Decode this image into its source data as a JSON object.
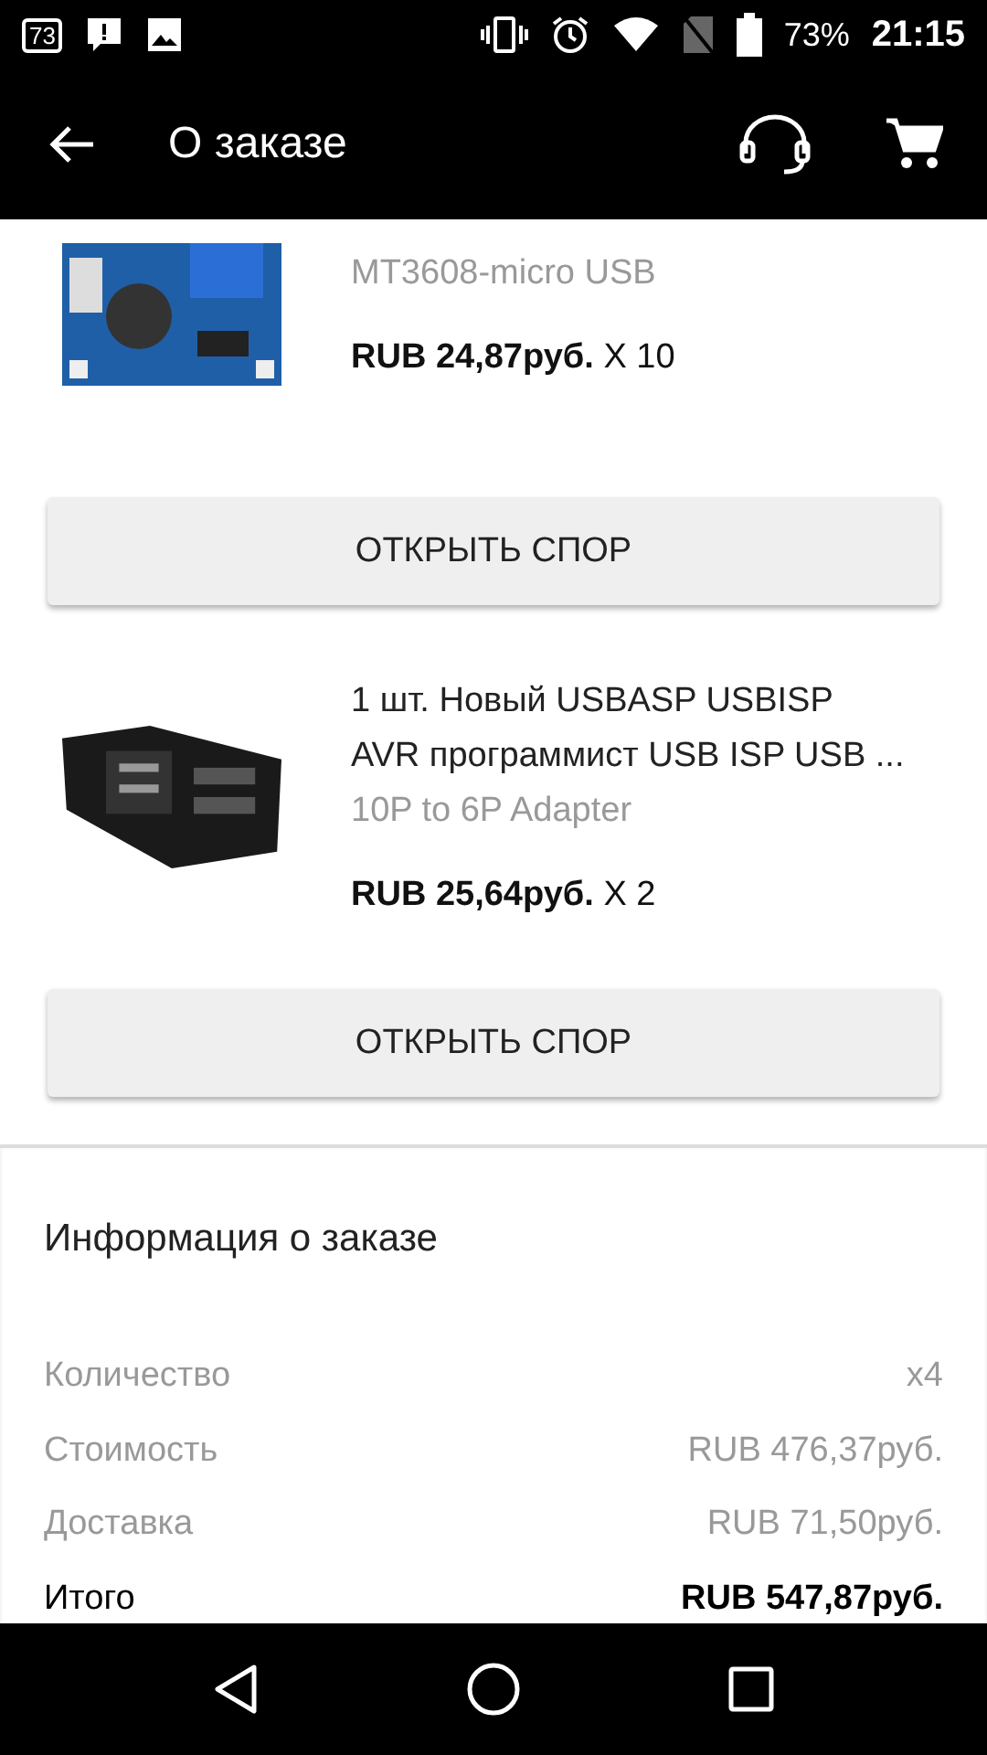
{
  "status_bar": {
    "notification_count": "73",
    "battery": "73%",
    "time": "21:15"
  },
  "app_bar": {
    "title": "О заказе"
  },
  "products": [
    {
      "subtitle": "MT3608-micro USB",
      "price": "RUB 24,87руб.",
      "quantity": "X 10",
      "button": "ОТКРЫТЬ СПОР"
    },
    {
      "title_lines": [
        "1 шт. Новый USBASP USBISP",
        "AVR программист USB ISP USB ..."
      ],
      "subtitle": "10P to 6P Adapter",
      "price": "RUB 25,64руб.",
      "quantity": "X 2",
      "button": "ОТКРЫТЬ СПОР"
    }
  ],
  "order_info": {
    "title": "Информация о заказе",
    "rows": [
      {
        "label": "Количество",
        "value": "x4",
        "kind": "plain"
      },
      {
        "label": "Стоимость",
        "value": "RUB 476,37руб.",
        "kind": "plain"
      },
      {
        "label": "Доставка",
        "value": "RUB 71,50руб.",
        "kind": "plain"
      },
      {
        "label": "Итого",
        "value": "RUB 547,87руб.",
        "kind": "total"
      }
    ]
  }
}
